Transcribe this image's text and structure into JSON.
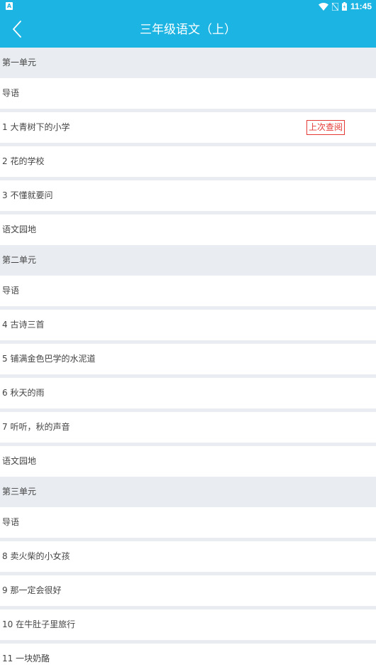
{
  "status": {
    "time": "11:45",
    "left_icon_letter": "A"
  },
  "header": {
    "title": "三年级语文（上）"
  },
  "units": [
    {
      "title": "第一单元",
      "lessons": [
        {
          "label": "导语"
        },
        {
          "label": "1 大青树下的小学",
          "badge": "上次查阅"
        },
        {
          "label": "2 花的学校"
        },
        {
          "label": "3 不懂就要问"
        },
        {
          "label": "语文园地"
        }
      ]
    },
    {
      "title": "第二单元",
      "lessons": [
        {
          "label": "导语"
        },
        {
          "label": "4 古诗三首"
        },
        {
          "label": "5 铺满金色巴学的水泥道"
        },
        {
          "label": "6 秋天的雨"
        },
        {
          "label": "7 听听，秋的声音"
        },
        {
          "label": "语文园地"
        }
      ]
    },
    {
      "title": "第三单元",
      "lessons": [
        {
          "label": "导语"
        },
        {
          "label": "8 卖火柴的小女孩"
        },
        {
          "label": "9 那一定会很好"
        },
        {
          "label": "10 在牛肚子里旅行"
        },
        {
          "label": "11 一块奶酪"
        }
      ]
    }
  ],
  "colors": {
    "accent": "#1cb4e3",
    "badge": "#e53935",
    "section_bg": "#e9edf1"
  }
}
